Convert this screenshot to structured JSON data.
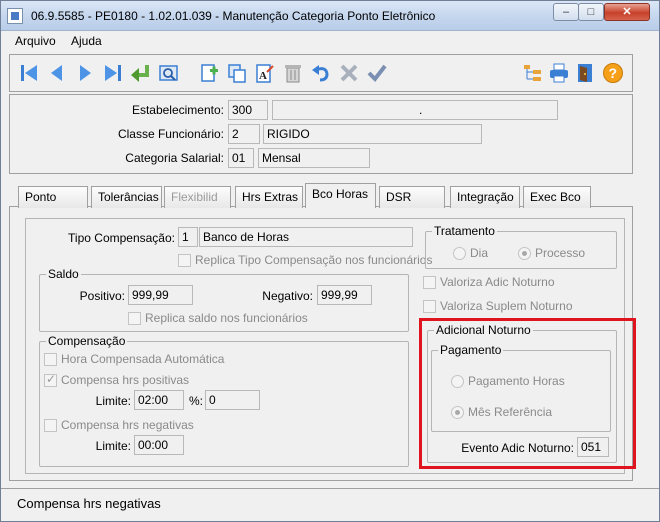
{
  "window": {
    "title": "06.9.5585 - PE0180 - 1.02.01.039 - Manutenção Categoria Ponto Eletrônico",
    "minimize": "–",
    "maximize": "□",
    "close": "✕"
  },
  "menu": {
    "items": [
      "Arquivo",
      "Ajuda"
    ]
  },
  "toolbar": {
    "buttons": [
      "first-record-icon",
      "previous-record-icon",
      "next-record-icon",
      "last-record-icon",
      "goto-record-icon",
      "search-icon",
      "new-record-icon",
      "copy-record-icon",
      "edit-record-icon",
      "delete-record-icon",
      "undo-icon",
      "cancel-icon",
      "save-icon",
      "tree-icon",
      "print-icon",
      "exit-icon",
      "help-icon"
    ]
  },
  "header": {
    "estabelecimento": {
      "label": "Estabelecimento:",
      "code": "300",
      "desc": "."
    },
    "classe": {
      "label": "Classe Funcionário:",
      "code": "2",
      "desc": "RIGIDO"
    },
    "categoria": {
      "label": "Categoria Salarial:",
      "code": "01",
      "desc": "Mensal"
    }
  },
  "tabs": [
    {
      "label": "Ponto",
      "state": "normal"
    },
    {
      "label": "Tolerâncias",
      "state": "normal"
    },
    {
      "label": "Flexibilid",
      "state": "disabled"
    },
    {
      "label": "Hrs Extras",
      "state": "normal"
    },
    {
      "label": "Bco Horas",
      "state": "active"
    },
    {
      "label": "DSR",
      "state": "normal"
    },
    {
      "label": "Integração",
      "state": "normal"
    },
    {
      "label": "Exec Bco",
      "state": "normal"
    }
  ],
  "bco": {
    "tipo": {
      "label": "Tipo Compensação:",
      "code": "1",
      "desc": "Banco de Horas"
    },
    "replica_tipo": "Replica Tipo Compensação nos funcionários",
    "saldo": {
      "title": "Saldo",
      "positivo_label": "Positivo:",
      "positivo_value": "999,99",
      "negativo_label": "Negativo:",
      "negativo_value": "999,99",
      "replica": "Replica saldo nos funcionários"
    },
    "compensacao": {
      "title": "Compensação",
      "hora_auto": "Hora Compensada Automática",
      "compensa_pos": "Compensa hrs positivas",
      "limite_label": "Limite:",
      "limite_pos_value": "02:00",
      "pct_label": "%:",
      "pct_value": "0",
      "compensa_neg": "Compensa hrs negativas",
      "limite_neg_value": "00:00"
    },
    "tratamento": {
      "title": "Tratamento",
      "dia": "Dia",
      "processo": "Processo"
    },
    "valoriza_adic": "Valoriza Adic Noturno",
    "valoriza_suplem": "Valoriza Suplem Noturno",
    "adicional": {
      "title": "Adicional Noturno",
      "pagamento_title": "Pagamento",
      "pagamento_horas": "Pagamento Horas",
      "mes_referencia": "Mês Referência",
      "evento_label": "Evento Adic Noturno:",
      "evento_value": "051"
    }
  },
  "status": {
    "text": "Compensa hrs negativas"
  },
  "colors": {
    "highlight": "#e0141e",
    "titlebar": "#c6d7ee"
  }
}
